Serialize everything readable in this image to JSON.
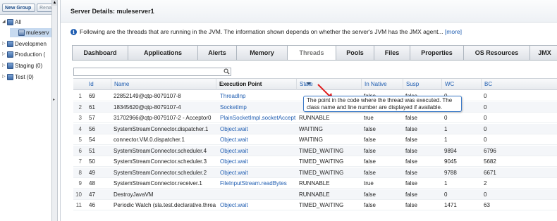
{
  "sidebar": {
    "new_group_label": "New Group",
    "rename_label": "Rena",
    "tree": [
      {
        "label": "All",
        "expander": "◢"
      },
      {
        "label": "muleserv",
        "expander": ""
      },
      {
        "label": "Developmen",
        "expander": "▷"
      },
      {
        "label": "Production (",
        "expander": "▷"
      },
      {
        "label": "Staging (0)",
        "expander": "▷"
      },
      {
        "label": "Test (0)",
        "expander": "▷"
      }
    ]
  },
  "main": {
    "title": "Server Details: muleserver1",
    "info_text": "Following are the threads that are running in the JVM. The information shown depends on whether the server's JVM has the JMX agent...",
    "more_link": "[more]",
    "tabs": [
      {
        "label": "Dashboard"
      },
      {
        "label": "Applications"
      },
      {
        "label": "Alerts"
      },
      {
        "label": "Memory"
      },
      {
        "label": "Threads"
      },
      {
        "label": "Pools"
      },
      {
        "label": "Files"
      },
      {
        "label": "Properties"
      },
      {
        "label": "OS Resources"
      },
      {
        "label": "JMX"
      }
    ],
    "active_tab": "Threads",
    "search": {
      "value": "",
      "placeholder": ""
    },
    "columns": [
      "Id",
      "Name",
      "Execution Point",
      "State",
      "In Native",
      "Susp",
      "WC",
      "BC"
    ],
    "rows": [
      {
        "n": "1",
        "id": "69",
        "name": "22852149@qtp-8079107-8",
        "exec": "ThreadInp",
        "state": "",
        "native": "false",
        "susp": "false",
        "wc": "0",
        "bc": "0"
      },
      {
        "n": "2",
        "id": "61",
        "name": "18345620@qtp-8079107-4",
        "exec": "SocketImp",
        "state": "",
        "native": "false",
        "susp": "false",
        "wc": "0",
        "bc": "0"
      },
      {
        "n": "3",
        "id": "57",
        "name": "31702966@qtp-8079107-2 - Acceptor0",
        "exec": "PlainSocketImpl.socketAccept",
        "state": "RUNNABLE",
        "native": "true",
        "susp": "false",
        "wc": "0",
        "bc": "0"
      },
      {
        "n": "4",
        "id": "56",
        "name": "SystemStreamConnector.dispatcher.1",
        "exec": "Object.wait",
        "state": "WAITING",
        "native": "false",
        "susp": "false",
        "wc": "1",
        "bc": "0"
      },
      {
        "n": "5",
        "id": "54",
        "name": "connector.VM.0.dispatcher.1",
        "exec": "Object.wait",
        "state": "WAITING",
        "native": "false",
        "susp": "false",
        "wc": "1",
        "bc": "0"
      },
      {
        "n": "6",
        "id": "51",
        "name": "SystemStreamConnector.scheduler.4",
        "exec": "Object.wait",
        "state": "TIMED_WAITING",
        "native": "false",
        "susp": "false",
        "wc": "9894",
        "bc": "6796"
      },
      {
        "n": "7",
        "id": "50",
        "name": "SystemStreamConnector.scheduler.3",
        "exec": "Object.wait",
        "state": "TIMED_WAITING",
        "native": "false",
        "susp": "false",
        "wc": "9045",
        "bc": "5682"
      },
      {
        "n": "8",
        "id": "49",
        "name": "SystemStreamConnector.scheduler.2",
        "exec": "Object.wait",
        "state": "TIMED_WAITING",
        "native": "false",
        "susp": "false",
        "wc": "9788",
        "bc": "6671"
      },
      {
        "n": "9",
        "id": "48",
        "name": "SystemStreamConnector.receiver.1",
        "exec": "FileInputStream.readBytes",
        "state": "RUNNABLE",
        "native": "true",
        "susp": "false",
        "wc": "1",
        "bc": "2"
      },
      {
        "n": "10",
        "id": "47",
        "name": "DestroyJavaVM",
        "exec": "",
        "state": "RUNNABLE",
        "native": "false",
        "susp": "false",
        "wc": "0",
        "bc": "0"
      },
      {
        "n": "11",
        "id": "46",
        "name": "Periodic Watch (sla.test.declarative.threa",
        "exec": "Object.wait",
        "state": "TIMED_WAITING",
        "native": "false",
        "susp": "false",
        "wc": "1471",
        "bc": "63"
      }
    ],
    "tooltip": "The point in the code where the thread was executed. The class name and line number are displayed if available."
  },
  "colors": {
    "link": "#1f5db1",
    "tooltip_border": "#3c7ac8",
    "arrow": "#e02020",
    "selection": "#c7daf0"
  }
}
